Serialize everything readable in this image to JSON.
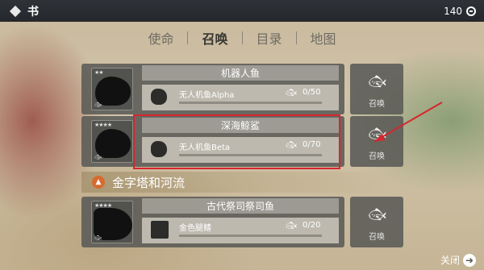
{
  "header": {
    "title": "书",
    "currency": "140"
  },
  "tabs": [
    {
      "label": "使命"
    },
    {
      "label": "召唤"
    },
    {
      "label": "目录"
    },
    {
      "label": "地图"
    }
  ],
  "cards": [
    {
      "stars": "★★",
      "name": "机器人鱼",
      "item_name": "无人机鱼Alpha",
      "count": "0/50",
      "progress": 0,
      "summon": "召唤"
    },
    {
      "stars": "★★★★",
      "name": "深海鲸鲨",
      "item_name": "无人机鱼Beta",
      "count": "0/70",
      "progress": 0,
      "summon": "召唤"
    },
    {
      "stars": "★★★★",
      "name": "古代祭司祭司鱼",
      "item_name": "金色腿鳍",
      "count": "0/20",
      "progress": 0,
      "summon": "召唤"
    }
  ],
  "section": {
    "title": "金字塔和河流"
  },
  "footer": {
    "close_label": "关闭"
  },
  "colors": {
    "highlight": "#d7262e",
    "topbar": "#2f3338",
    "section_icon": "#d86a2e"
  }
}
